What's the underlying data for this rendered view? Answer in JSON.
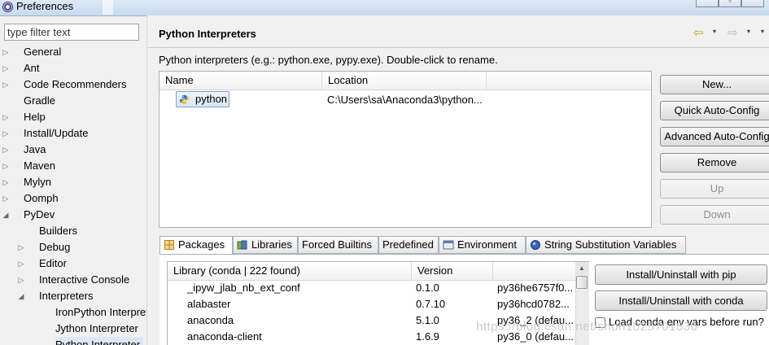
{
  "window": {
    "title": "Preferences"
  },
  "filter": {
    "placeholder": "type filter text"
  },
  "tree": [
    {
      "label": "General",
      "level": 0,
      "twisty": "right"
    },
    {
      "label": "Ant",
      "level": 0,
      "twisty": "right"
    },
    {
      "label": "Code Recommenders",
      "level": 0,
      "twisty": "right"
    },
    {
      "label": "Gradle",
      "level": 0,
      "twisty": "none"
    },
    {
      "label": "Help",
      "level": 0,
      "twisty": "right"
    },
    {
      "label": "Install/Update",
      "level": 0,
      "twisty": "right"
    },
    {
      "label": "Java",
      "level": 0,
      "twisty": "right"
    },
    {
      "label": "Maven",
      "level": 0,
      "twisty": "right"
    },
    {
      "label": "Mylyn",
      "level": 0,
      "twisty": "right"
    },
    {
      "label": "Oomph",
      "level": 0,
      "twisty": "right"
    },
    {
      "label": "PyDev",
      "level": 0,
      "twisty": "down"
    },
    {
      "label": "Builders",
      "level": 1,
      "twisty": "none"
    },
    {
      "label": "Debug",
      "level": 1,
      "twisty": "right"
    },
    {
      "label": "Editor",
      "level": 1,
      "twisty": "right"
    },
    {
      "label": "Interactive Console",
      "level": 1,
      "twisty": "right"
    },
    {
      "label": "Interpreters",
      "level": 1,
      "twisty": "down"
    },
    {
      "label": "IronPython Interpreter",
      "level": 2,
      "twisty": "none"
    },
    {
      "label": "Jython Interpreter",
      "level": 2,
      "twisty": "none"
    },
    {
      "label": "Python Interpreter",
      "level": 2,
      "twisty": "none",
      "selected": true
    }
  ],
  "page": {
    "title": "Python Interpreters",
    "description": "Python interpreters (e.g.: python.exe, pypy.exe).   Double-click to rename.",
    "nav": {
      "back_icon": "back-arrow-icon",
      "forward_icon": "forward-arrow-icon",
      "menu_glyph": "▾"
    }
  },
  "interpreters": {
    "columns": [
      "Name",
      "Location"
    ],
    "rows": [
      {
        "name": "python",
        "location": "C:\\Users\\sa\\Anaconda3\\python..."
      }
    ]
  },
  "buttons": {
    "new": "New...",
    "quick_auto_config": "Quick Auto-Config",
    "advanced_auto_config": "Advanced Auto-Config",
    "remove": "Remove",
    "up": "Up",
    "down": "Down"
  },
  "tabs": [
    {
      "label": "Packages",
      "icon": "packages-icon",
      "active": true
    },
    {
      "label": "Libraries",
      "icon": "libraries-icon"
    },
    {
      "label": "Forced Builtins"
    },
    {
      "label": "Predefined"
    },
    {
      "label": "Environment",
      "icon": "environment-icon"
    },
    {
      "label": "String Substitution Variables",
      "icon": "variables-icon"
    }
  ],
  "packages": {
    "columns": [
      "Library (conda | 222 found)",
      "Version"
    ],
    "rows": [
      {
        "name": "_ipyw_jlab_nb_ext_conf",
        "version": "0.1.0",
        "build": "py36he6757f0..."
      },
      {
        "name": "alabaster",
        "version": "0.7.10",
        "build": "py36hcd0782..."
      },
      {
        "name": "anaconda",
        "version": "5.1.0",
        "build": "py36_2 (defau..."
      },
      {
        "name": "anaconda-client",
        "version": "1.6.9",
        "build": "py36_0 (defau..."
      }
    ],
    "install_pip": "Install/Uninstall with pip",
    "install_conda": "Install/Uninstall with conda",
    "load_env_label": "Load conda env vars before run?"
  },
  "watermark": "https://blog.csdn.net/shdh1025701836"
}
